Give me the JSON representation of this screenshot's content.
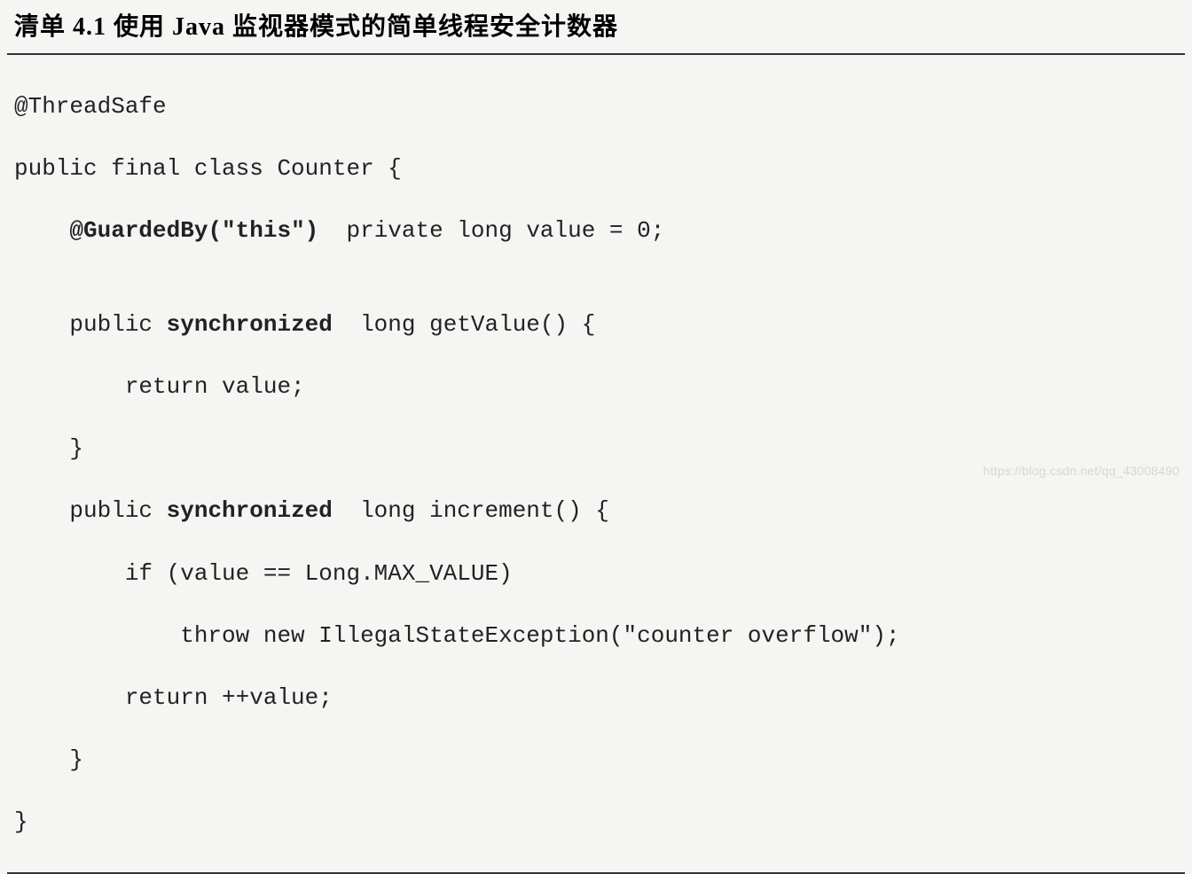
{
  "heading": "清单 4.1   使用 Java 监视器模式的简单线程安全计数器",
  "code": {
    "line1": "@ThreadSafe",
    "line2": "public final class Counter {",
    "line3_prefix": "    ",
    "line3_bold": "@GuardedBy(\"this\")",
    "line3_suffix": "  private long value = 0;",
    "line4": "",
    "line5_prefix": "    public ",
    "line5_bold": "synchronized",
    "line5_suffix": "  long getValue() {",
    "line6": "        return value;",
    "line7": "    }",
    "line8_prefix": "    public ",
    "line8_bold": "synchronized",
    "line8_suffix": "  long increment() {",
    "line9": "        if (value == Long.MAX_VALUE)",
    "line10": "            throw new IllegalStateException(\"counter overflow\");",
    "line11": "        return ++value;",
    "line12": "    }",
    "line13": "}"
  },
  "watermark": "https://blog.csdn.net/qq_43008490"
}
